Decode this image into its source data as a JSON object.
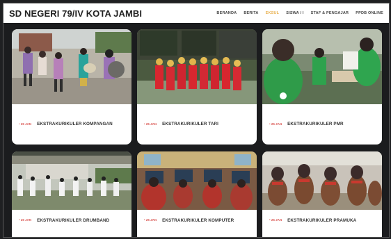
{
  "header": {
    "brand": "SD NEGERI 79/IV KOTA JAMBI",
    "nav": [
      {
        "label": "BERANDA",
        "active": false
      },
      {
        "label": "BERITA",
        "active": false
      },
      {
        "label": "EKSUL",
        "active": true
      },
      {
        "label": "SISWA / I",
        "active": false
      },
      {
        "label": "STAF & PENGAJAR",
        "active": false
      },
      {
        "label": "PPDB ONLINE",
        "active": false
      }
    ]
  },
  "cards": [
    {
      "tag": "• 25 JAN",
      "title": "EKSTRAKURIKULER KOMPANGAN",
      "photo": "kompangan-photo"
    },
    {
      "tag": "• 25 JAN",
      "title": "EKSTRAKURIKULER TARI",
      "photo": "tari-photo"
    },
    {
      "tag": "• 25 JAN",
      "title": "EKSTRAKURIKULER PMR",
      "photo": "pmr-photo"
    },
    {
      "tag": "• 25 JAN",
      "title": "EKSTRAKURIKULER DRUMBAND",
      "photo": "drumband-photo"
    },
    {
      "tag": "• 25 JAN",
      "title": "EKSTRAKURIKULER KOMPUTER",
      "photo": "komputer-photo"
    },
    {
      "tag": "• 25 JAN",
      "title": "EKSTRAKURIKULER PRAMUKA",
      "photo": "pramuka-photo"
    }
  ],
  "colors": {
    "accent": "#e8b04e",
    "tag": "#d9534f",
    "background": "#1b1c1e"
  }
}
